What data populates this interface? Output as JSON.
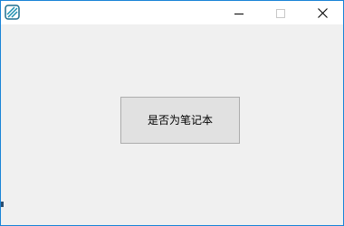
{
  "window": {
    "title": "",
    "border_color": "#1883d7",
    "icon": "app-logo-icon",
    "controls": {
      "minimize": "minimize-icon",
      "maximize": "maximize-icon",
      "close": "close-icon"
    }
  },
  "main": {
    "button_label": "是否为笔记本"
  }
}
